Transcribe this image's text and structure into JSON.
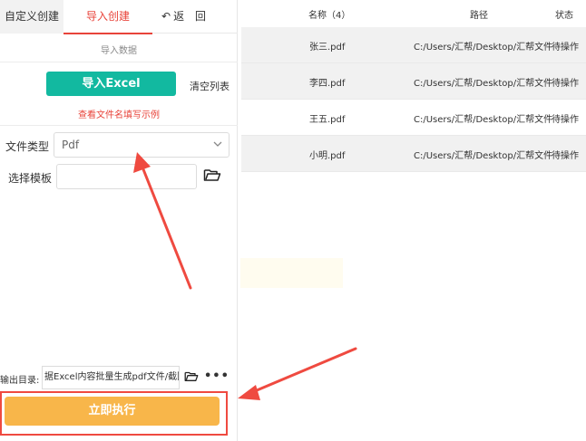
{
  "tabs": {
    "custom": "自定义创建",
    "import": "导入创建",
    "back": "返",
    "restore": "回"
  },
  "left": {
    "section_title": "导入数据",
    "import_excel": "导入Excel",
    "clear_list": "清空列表",
    "view_example": "查看文件名填写示例",
    "file_type_label": "文件类型",
    "file_type_value": "Pdf",
    "template_label": "选择模板",
    "template_value": "",
    "output_label": "输出目录:",
    "output_path": "据Excel内容批量生成pdf文件/截图",
    "run_button": "立即执行"
  },
  "table": {
    "headers": {
      "name": "名称（4）",
      "path": "路径",
      "status": "状态"
    },
    "rows": [
      {
        "name": "张三.pdf",
        "path": "C:/Users/汇帮/Desktop/汇帮文件",
        "status": "待操作"
      },
      {
        "name": "李四.pdf",
        "path": "C:/Users/汇帮/Desktop/汇帮文件",
        "status": "待操作"
      },
      {
        "name": "王五.pdf",
        "path": "C:/Users/汇帮/Desktop/汇帮文件",
        "status": "待操作"
      },
      {
        "name": "小明.pdf",
        "path": "C:/Users/汇帮/Desktop/汇帮文件",
        "status": "待操作"
      }
    ]
  },
  "colors": {
    "accent_red": "#e8433a",
    "excel_button": "#12b9a0",
    "run_button": "#f8b64a",
    "annotation": "#ef4a40"
  },
  "icons": [
    "undo-arrow-icon",
    "chevron-down-icon",
    "folder-open-icon",
    "more-dots-icon"
  ]
}
